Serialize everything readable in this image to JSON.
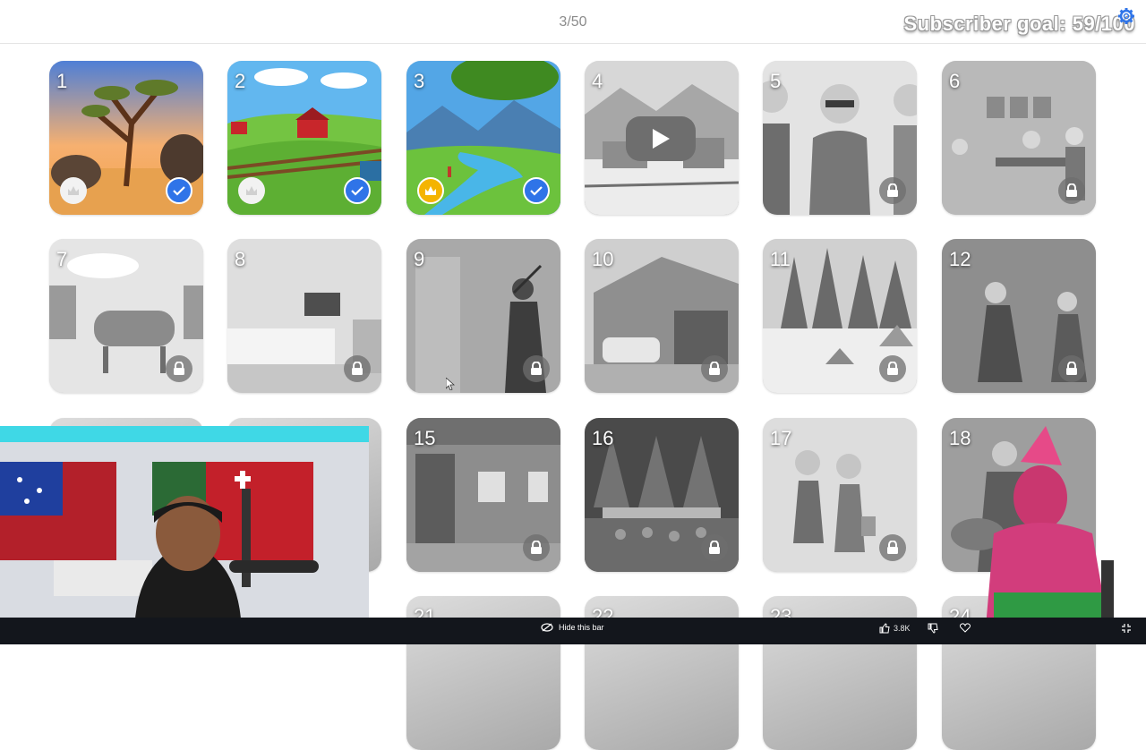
{
  "header": {
    "progress": "3/50",
    "subscriber_goal": "Subscriber goal: 59/100",
    "gear_icon": "gear-icon"
  },
  "cards": [
    {
      "number": "1",
      "status": "completed",
      "badge_left": "white-badge-icon",
      "badge_right": "check-icon"
    },
    {
      "number": "2",
      "status": "completed",
      "badge_left": "white-badge-icon",
      "badge_right": "check-icon"
    },
    {
      "number": "3",
      "status": "completed",
      "badge_left": "crown-icon",
      "badge_right": "check-icon"
    },
    {
      "number": "4",
      "status": "current",
      "badge_center": "play-icon"
    },
    {
      "number": "5",
      "status": "locked",
      "badge_right": "lock-icon"
    },
    {
      "number": "6",
      "status": "locked",
      "badge_right": "lock-icon"
    },
    {
      "number": "7",
      "status": "locked",
      "badge_right": "lock-icon"
    },
    {
      "number": "8",
      "status": "locked",
      "badge_right": "lock-icon"
    },
    {
      "number": "9",
      "status": "locked",
      "badge_right": "lock-icon"
    },
    {
      "number": "10",
      "status": "locked",
      "badge_right": "lock-icon"
    },
    {
      "number": "11",
      "status": "locked",
      "badge_right": "lock-icon"
    },
    {
      "number": "12",
      "status": "locked",
      "badge_right": "lock-icon"
    },
    {
      "number": "15",
      "status": "locked",
      "badge_right": "lock-icon"
    },
    {
      "number": "16",
      "status": "locked",
      "badge_right": "lock-icon"
    },
    {
      "number": "17",
      "status": "locked",
      "badge_right": "lock-icon"
    },
    {
      "number": "18",
      "status": "locked"
    },
    {
      "number": "21",
      "status": "locked"
    },
    {
      "number": "22",
      "status": "locked"
    },
    {
      "number": "23",
      "status": "locked"
    },
    {
      "number": "24",
      "status": "locked"
    }
  ],
  "bottom_bar": {
    "hide_label": "Hide this bar",
    "like_count": "3.8K"
  },
  "colors": {
    "accent": "#2f74e8",
    "crown": "#f4b400",
    "bar": "#13161c"
  }
}
